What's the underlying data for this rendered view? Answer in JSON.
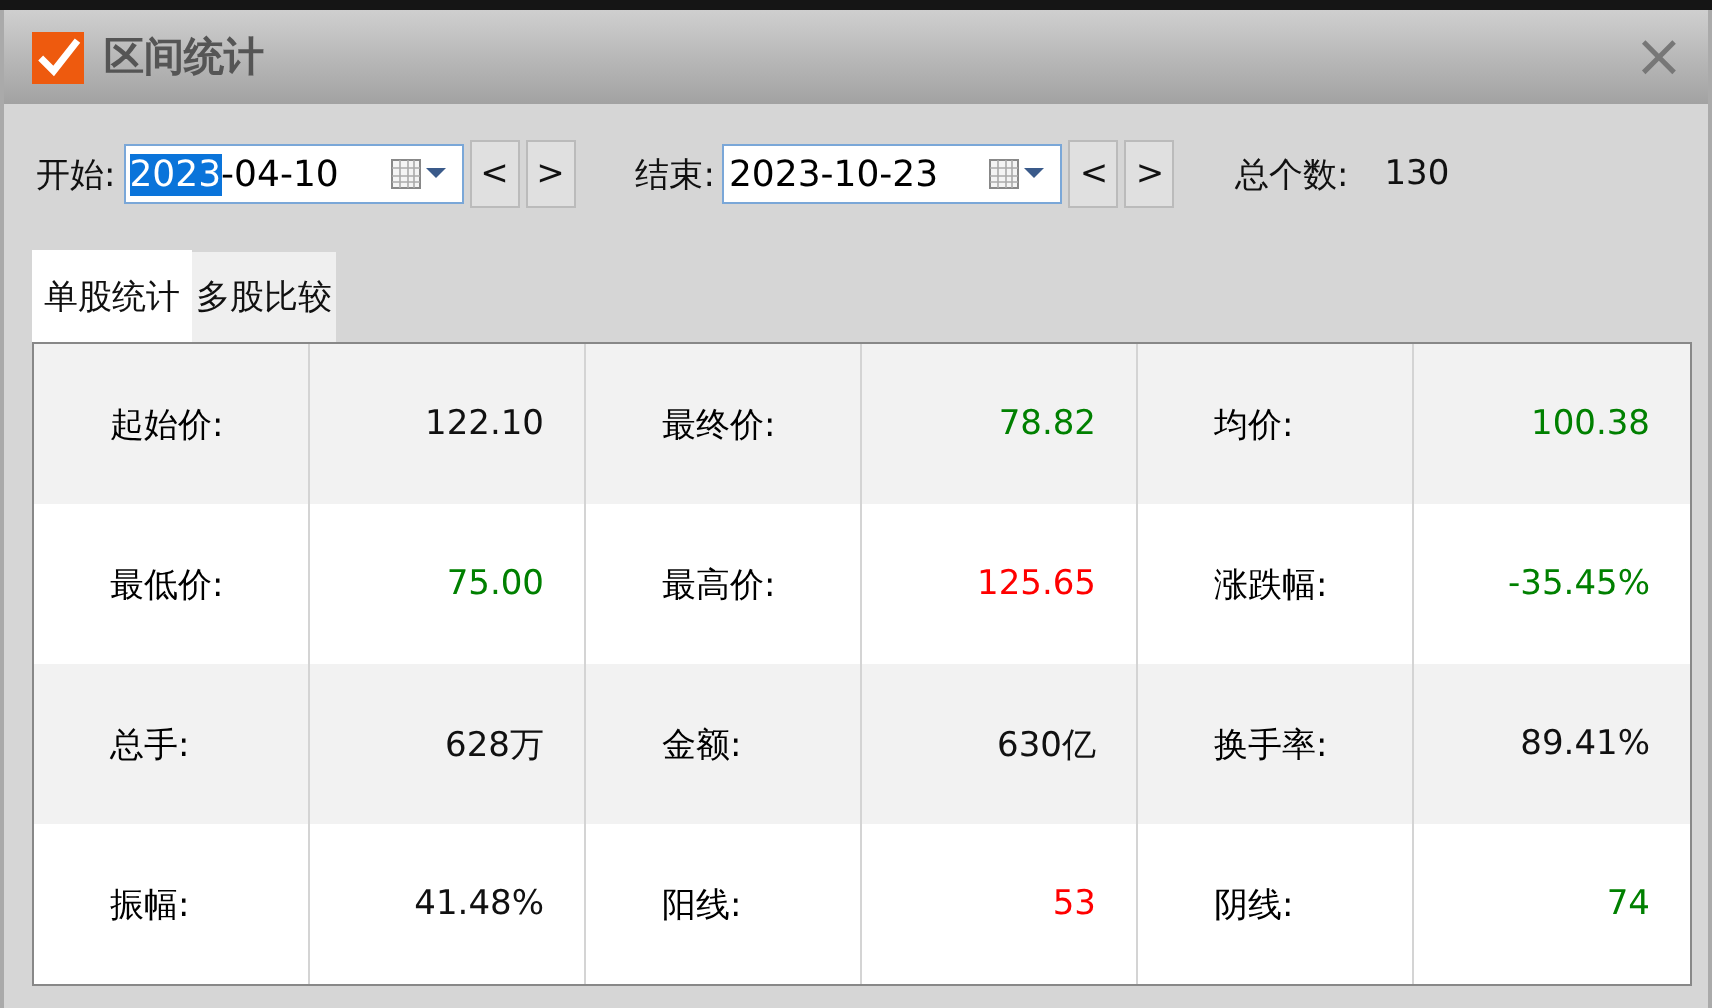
{
  "window": {
    "title": "区间统计",
    "close": "×"
  },
  "date_fields": [
    {
      "label": "开始:",
      "selected_part": "2023",
      "value": "-04-10",
      "prev": "<",
      "next": ">"
    },
    {
      "label": "结束:",
      "value": "2023-10-23",
      "prev": "<",
      "next": ">"
    }
  ],
  "total": {
    "label": "总个数:",
    "value": "130"
  },
  "tabs": [
    {
      "label": "单股统计",
      "selected": true
    },
    {
      "label": "多股比较",
      "selected": false
    }
  ],
  "stats": [
    [
      {
        "label": "起始价:",
        "value": "122.10",
        "color": "#111111"
      },
      {
        "label": "最终价:",
        "value": "78.82",
        "color": "#008000"
      },
      {
        "label": "均价:",
        "value": "100.38",
        "color": "#008000"
      }
    ],
    [
      {
        "label": "最低价:",
        "value": "75.00",
        "color": "#008000"
      },
      {
        "label": "最高价:",
        "value": "125.65",
        "color": "#ff0000"
      },
      {
        "label": "涨跌幅:",
        "value": "-35.45%",
        "color": "#008000"
      }
    ],
    [
      {
        "label": "总手:",
        "value": "628万",
        "color": "#111111"
      },
      {
        "label": "金额:",
        "value": "630亿",
        "color": "#111111"
      },
      {
        "label": "换手率:",
        "value": "89.41%",
        "color": "#111111"
      }
    ],
    [
      {
        "label": "振幅:",
        "value": "41.48%",
        "color": "#111111"
      },
      {
        "label": "阳线:",
        "value": "53",
        "color": "#ff0000"
      },
      {
        "label": "阴线:",
        "value": "74",
        "color": "#008000"
      }
    ]
  ]
}
